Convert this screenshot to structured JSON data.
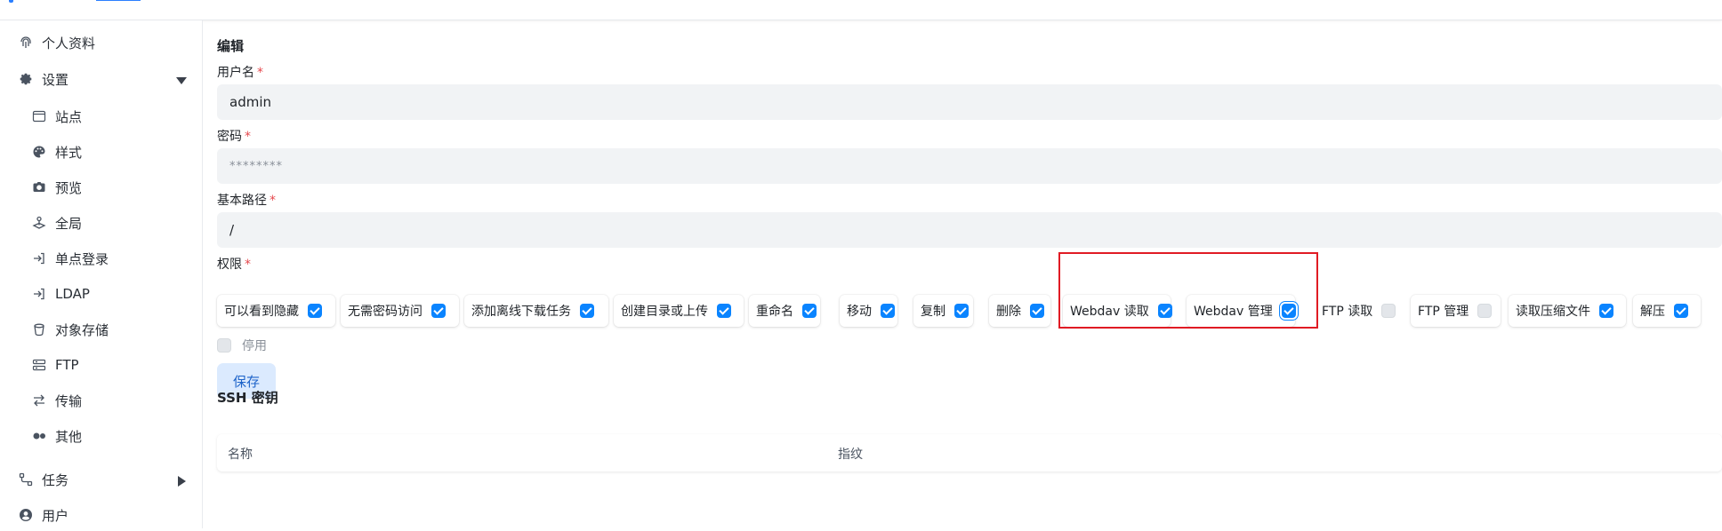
{
  "sidebar": {
    "items": [
      {
        "label": "个人资料",
        "icon": "fingerprint-icon"
      },
      {
        "label": "设置",
        "icon": "gear-icon"
      },
      {
        "label": "站点",
        "icon": "window-icon"
      },
      {
        "label": "样式",
        "icon": "palette-icon"
      },
      {
        "label": "预览",
        "icon": "camera-icon"
      },
      {
        "label": "全局",
        "icon": "joystick-icon"
      },
      {
        "label": "单点登录",
        "icon": "login-arrow-icon"
      },
      {
        "label": "LDAP",
        "icon": "login-arrow-icon"
      },
      {
        "label": "对象存储",
        "icon": "bucket-icon"
      },
      {
        "label": "FTP",
        "icon": "server-icon"
      },
      {
        "label": "传输",
        "icon": "transfer-arrows-icon"
      },
      {
        "label": "其他",
        "icon": "toggle-dots-icon"
      },
      {
        "label": "任务",
        "icon": "flow-icon"
      },
      {
        "label": "用户",
        "icon": "user-circle-icon"
      }
    ]
  },
  "main": {
    "title": "编辑",
    "username": {
      "label": "用户名",
      "required": "*",
      "value": "admin"
    },
    "password": {
      "label": "密码",
      "required": "*",
      "placeholder": "********"
    },
    "base_path": {
      "label": "基本路径",
      "required": "*",
      "value": "/"
    },
    "permissions": {
      "label": "权限",
      "required": "*",
      "items": [
        {
          "label": "可以看到隐藏",
          "checked": true
        },
        {
          "label": "无需密码访问",
          "checked": true
        },
        {
          "label": "添加离线下载任务",
          "checked": true
        },
        {
          "label": "创建目录或上传",
          "checked": true
        },
        {
          "label": "重命名",
          "checked": true
        },
        {
          "label": "移动",
          "checked": true
        },
        {
          "label": "复制",
          "checked": true
        },
        {
          "label": "删除",
          "checked": true
        },
        {
          "label": "Webdav 读取",
          "checked": true
        },
        {
          "label": "Webdav 管理",
          "checked": true
        },
        {
          "label": "FTP 读取",
          "checked": false
        },
        {
          "label": "FTP 管理",
          "checked": false
        },
        {
          "label": "读取压缩文件",
          "checked": true
        },
        {
          "label": "解压",
          "checked": true
        }
      ]
    },
    "disabled": {
      "label": "停用",
      "checked": false
    },
    "save_label": "保存",
    "ssh": {
      "title": "SSH 密钥",
      "columns": [
        "名称",
        "指纹"
      ]
    }
  },
  "colors": {
    "accent": "#0a84ff",
    "highlight_box": "#e01b24",
    "required": "#e5484d"
  }
}
